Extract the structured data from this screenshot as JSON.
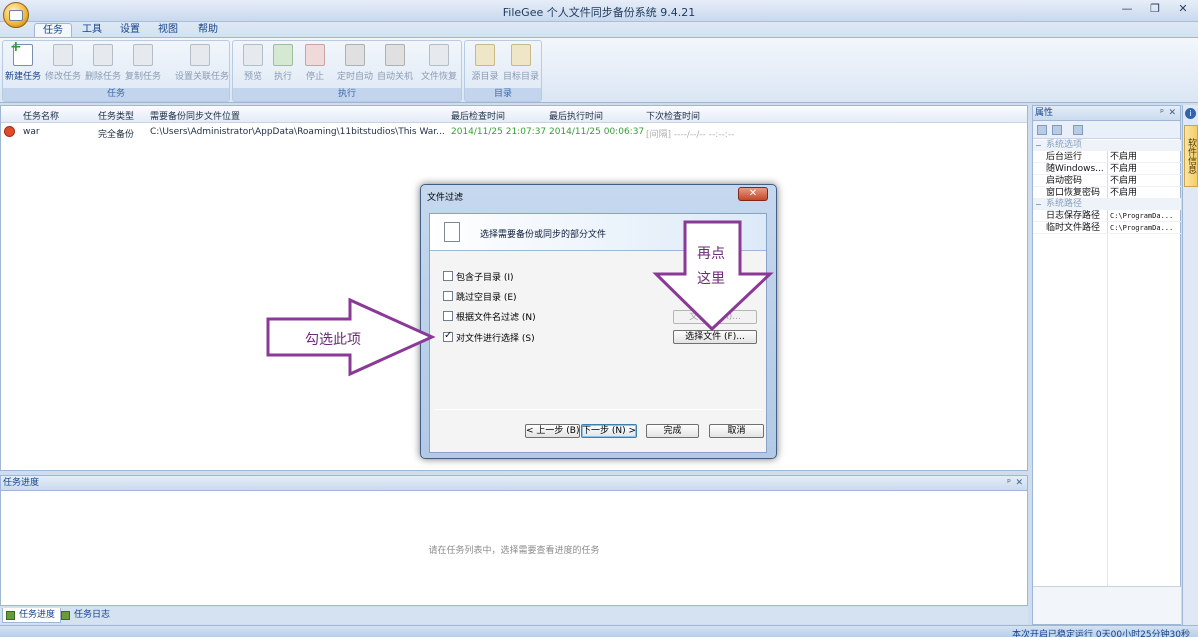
{
  "window": {
    "title": "FileGee 个人文件同步备份系统 9.4.21",
    "minimize_icon": "minimize-icon",
    "maximize_icon": "restore-icon",
    "close_icon": "close-icon"
  },
  "menu": {
    "tabs": [
      "任务",
      "工具",
      "设置",
      "视图",
      "帮助"
    ],
    "active": "任务"
  },
  "ribbon": {
    "groups": [
      {
        "label": "任务",
        "buttons": [
          "新建任务",
          "修改任务",
          "删除任务",
          "复制任务",
          "设置关联任务"
        ]
      },
      {
        "label": "执行",
        "buttons": [
          "预览",
          "执行",
          "停止",
          "定时自动",
          "自动关机",
          "文件恢复"
        ]
      },
      {
        "label": "目录",
        "buttons": [
          "源目录",
          "目标目录"
        ]
      }
    ]
  },
  "task_list": {
    "columns": [
      "任务名称",
      "任务类型",
      "需要备份同步文件位置",
      "最后检查时间",
      "最后执行时间",
      "下次检查时间"
    ],
    "rows": [
      {
        "name": "war",
        "type": "完全备份",
        "path": "C:\\Users\\Administrator\\AppData\\Roaming\\11bitstudios\\This War...",
        "last_check": "2014/11/25 21:07:37",
        "last_run": "2014/11/25 00:06:37",
        "next_check": "[间隔] ----/--/-- --:--:--"
      }
    ]
  },
  "progress_pane": {
    "title": "任务进度",
    "pin": "ᵖ",
    "close": "✕",
    "empty_message": "请在任务列表中，选择需要查看进度的任务"
  },
  "bottom_tabs": [
    "任务进度",
    "任务日志"
  ],
  "properties": {
    "title": "属性",
    "pin": "ᵖ",
    "close": "✕",
    "categories": [
      {
        "name": "系统选项",
        "rows": [
          {
            "key": "后台运行",
            "value": "不启用"
          },
          {
            "key": "随Windows...",
            "value": "不启用"
          },
          {
            "key": "启动密码",
            "value": "不启用"
          },
          {
            "key": "窗口恢复密码",
            "value": "不启用"
          }
        ]
      },
      {
        "name": "系统路径",
        "rows": [
          {
            "key": "日志保存路径",
            "value": "C:\\ProgramDa..."
          },
          {
            "key": "临时文件路径",
            "value": "C:\\ProgramDa..."
          }
        ]
      }
    ]
  },
  "side_tab": {
    "label": "软件信息",
    "help": "i"
  },
  "statusbar": {
    "text": "本次开启已稳定运行 0天00小时25分钟30秒"
  },
  "dialog": {
    "title": "文件过滤",
    "close": "✕",
    "banner": "选择需要备份或同步的部分文件",
    "options": [
      {
        "label": "包含子目录 (I)",
        "checked": false
      },
      {
        "label": "跳过空目录 (E)",
        "checked": false
      },
      {
        "label": "根据文件名过滤 (N)",
        "checked": false
      },
      {
        "label": "对文件进行选择 (S)",
        "checked": true
      }
    ],
    "filename_button": "文件名 (A)...",
    "select_files_button": "选择文件 (F)...",
    "back_button": "< 上一步 (B)",
    "next_button": "下一步 (N) >",
    "finish_button": "完成",
    "cancel_button": "取消"
  },
  "annotations": {
    "left_arrow_text": "勾选此项",
    "down_arrow_text_line1": "再点",
    "down_arrow_text_line2": "这里",
    "color": "#8a3a96"
  }
}
